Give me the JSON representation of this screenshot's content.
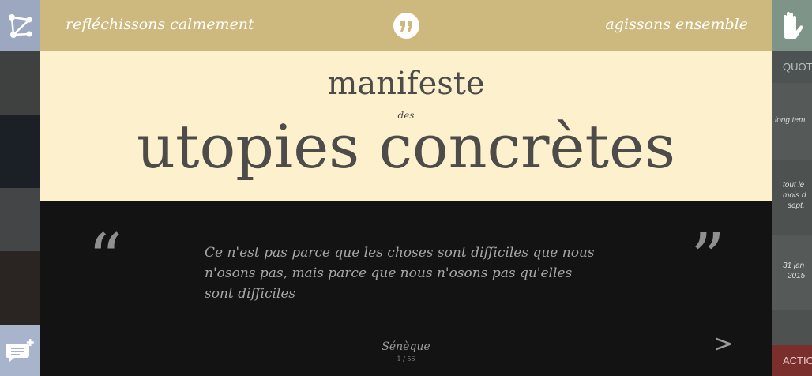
{
  "header": {
    "tagline_left": "refléchissons calmement",
    "tagline_right": "agissons ensemble",
    "quote_badge_icon": "quote-icon"
  },
  "title": {
    "line1": "manifeste",
    "line2": "des",
    "line3": "utopies concrètes"
  },
  "quote": {
    "open_mark": "“",
    "close_mark": "”",
    "text": "Ce n'est pas parce que les choses sont difficiles que nous n'osons pas, mais parce que nous n'osons pas qu'elles sont difficiles",
    "author": "Sénèque",
    "page": "1 / 56",
    "next_label": ">"
  },
  "left_panel": {
    "top_icon": "network-icon",
    "bottom_icon": "add-comment-icon"
  },
  "right_panel": {
    "top_icon": "hand-icon",
    "tab_label": "QUOT",
    "items": [
      "long tem",
      "tout le",
      "mois d",
      "sept.",
      "31 jan",
      "2015"
    ],
    "action_label": "ACTIO"
  },
  "colors": {
    "header_bg": "#cdb87e",
    "title_bg": "#fdf1cd",
    "quote_bg": "#131313",
    "left_button": "#9ca8c0",
    "right_button": "#7e9488",
    "action_button": "#7a2f2d"
  }
}
